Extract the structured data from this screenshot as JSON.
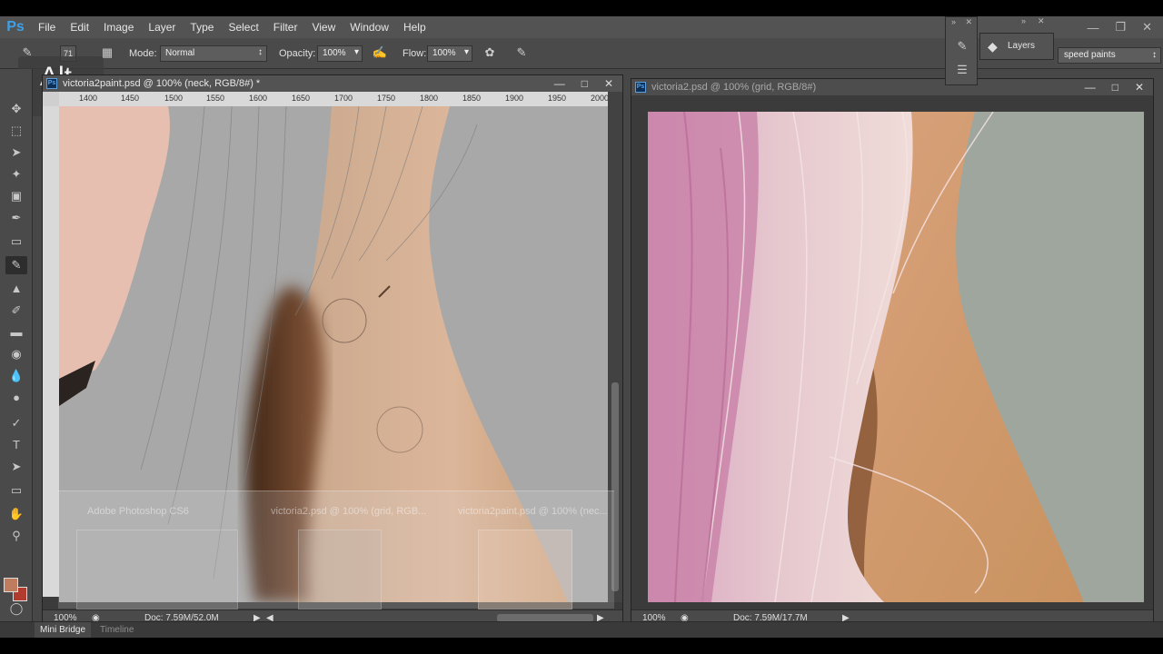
{
  "menubar": {
    "logo": "Ps",
    "items": [
      "File",
      "Edit",
      "Image",
      "Layer",
      "Type",
      "Select",
      "Filter",
      "View",
      "Window",
      "Help"
    ]
  },
  "options": {
    "brush_size": "71",
    "mode_label": "Mode:",
    "mode_value": "Normal",
    "opacity_label": "Opacity:",
    "opacity_value": "100%",
    "flow_label": "Flow:",
    "flow_value": "100%"
  },
  "overlay": {
    "key": "Alt"
  },
  "doc1": {
    "title": "victoria2paint.psd @ 100% (neck, RGB/8#) *",
    "ruler": [
      "1400",
      "1450",
      "1500",
      "1550",
      "1600",
      "1650",
      "1700",
      "1750",
      "1800",
      "1850",
      "1900",
      "1950",
      "2000"
    ],
    "zoom": "100%",
    "doc_size": "Doc: 7.59M/52.0M"
  },
  "switcher": {
    "items": [
      "Adobe Photoshop CS6",
      "victoria2.psd @ 100% (grid, RGB...",
      "victoria2paint.psd @ 100% (nec..."
    ]
  },
  "doc2": {
    "title": "victoria2.psd @ 100% (grid, RGB/8#)",
    "zoom": "100%",
    "doc_size": "Doc: 7.59M/17.7M"
  },
  "panels": {
    "layers_label": "Layers",
    "workspace": "speed paints"
  },
  "bottom_tabs": [
    "Mini Bridge",
    "Timeline"
  ],
  "colors": {
    "foreground": "#c07c5e",
    "background": "#b13b2e"
  },
  "icons": {
    "tools": [
      "move-icon",
      "marquee-icon",
      "lasso-icon",
      "quick-select-icon",
      "crop-icon",
      "eyedropper-icon",
      "healing-brush-icon",
      "brush-icon",
      "clone-stamp-icon",
      "history-brush-icon",
      "eraser-icon",
      "paint-bucket-icon",
      "blur-icon",
      "dodge-icon",
      "pen-icon",
      "type-icon",
      "path-select-icon",
      "rectangle-icon",
      "hand-icon",
      "zoom-icon"
    ]
  }
}
